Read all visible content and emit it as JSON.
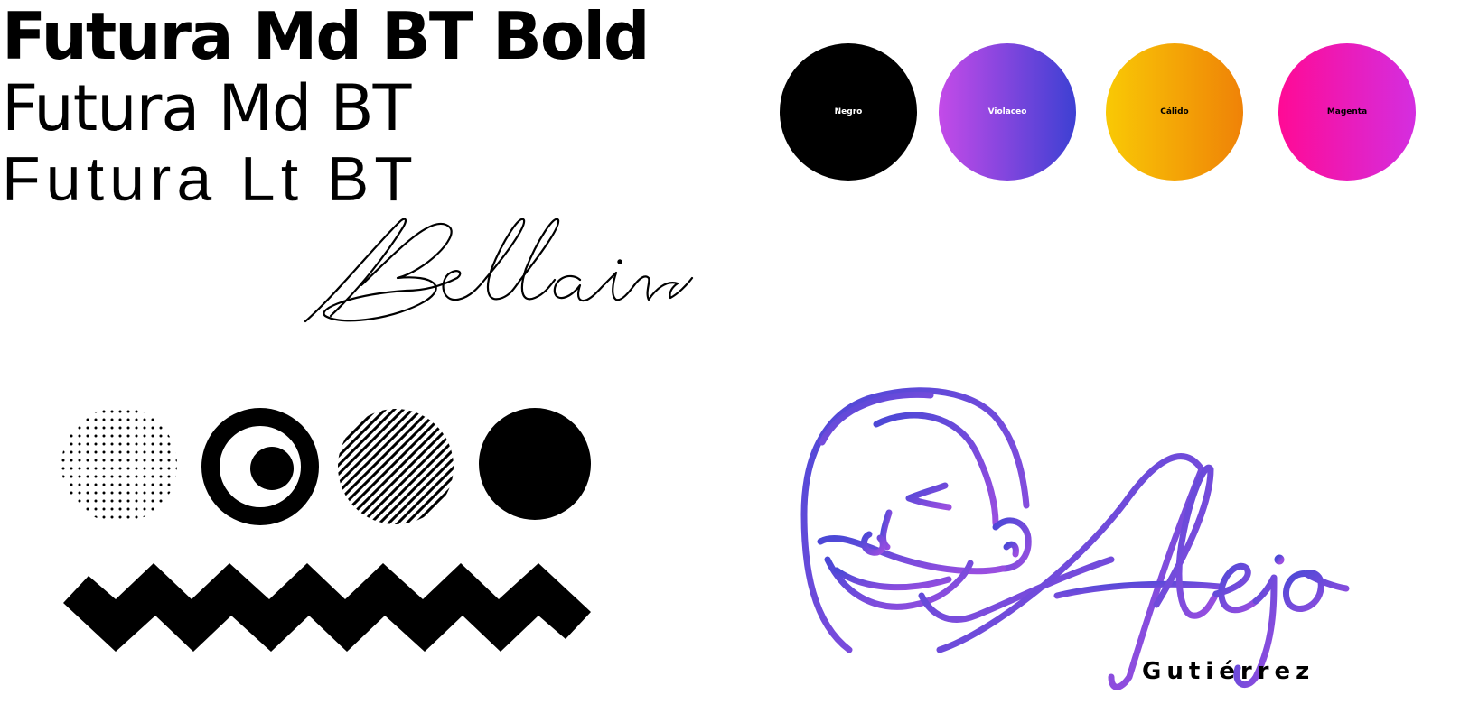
{
  "typography": {
    "primary_bold": "Futura Md BT Bold",
    "primary_medium": "Futura Md BT",
    "primary_light": "Futura Lt BT",
    "script": "Bellair"
  },
  "palette": [
    {
      "label": "Negro",
      "from": "#000000",
      "to": "#000000",
      "text_color": "#ffffff"
    },
    {
      "label": "Violaceo",
      "from": "#c44be8",
      "to": "#3d40d3",
      "text_color": "#ffffff"
    },
    {
      "label": "Cálido",
      "from": "#f9c905",
      "to": "#ef8207",
      "text_color": "#000000"
    },
    {
      "label": "Magenta",
      "from": "#ff0a95",
      "to": "#d42ee0",
      "text_color": "#000000"
    }
  ],
  "graphic_elements": [
    "dotted-circle",
    "target-circle",
    "striped-circle",
    "solid-circle",
    "zigzag-band"
  ],
  "logo": {
    "name": "Alejo",
    "surname": "Gutiérrez",
    "gradient_from": "#4a48d6",
    "gradient_to": "#9b4ee0"
  }
}
